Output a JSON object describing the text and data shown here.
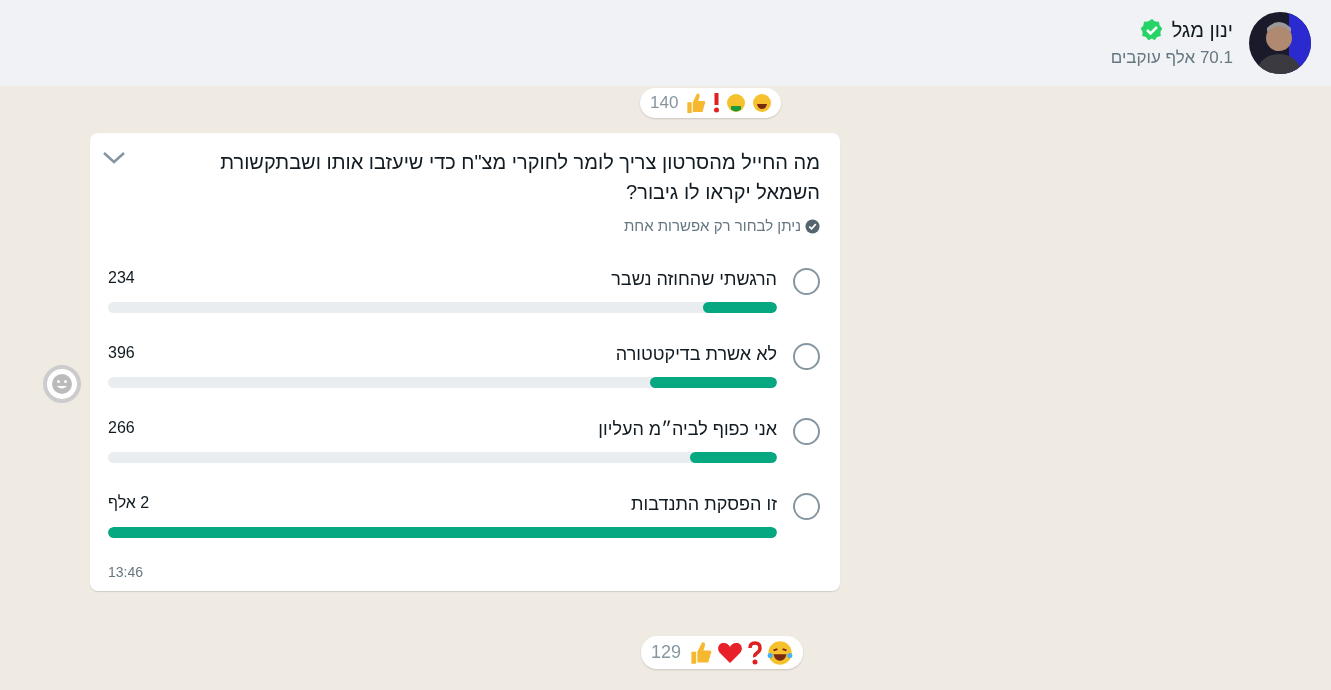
{
  "header": {
    "name": "ינון מגל",
    "verified": true,
    "followers": "70.1 אלף עוקבים"
  },
  "previous_reactions": {
    "count": "140"
  },
  "poll": {
    "question": "מה החייל מהסרטון צריך לומר לחוקרי מצ\"ח כדי שיעזבו אותו ושבתקשורת השמאל יקראו לו גיבור?",
    "hint": "ניתן לבחור רק אפשרות אחת",
    "options": [
      {
        "label": "הרגשתי שהחוזה נשבר",
        "votes": "234",
        "level": 0.11,
        "selected": false
      },
      {
        "label": "לא אשרת בדיקטטורה",
        "votes": "396",
        "level": 0.19,
        "selected": false
      },
      {
        "label": "אני כפוף לביה״מ העליון",
        "votes": "266",
        "level": 0.13,
        "selected": false
      },
      {
        "label": "זו הפסקת התנדבות",
        "votes": "2 אלף",
        "level": 1.0,
        "selected": false
      }
    ],
    "time": "13:46"
  },
  "reactions": {
    "count": "129"
  }
}
